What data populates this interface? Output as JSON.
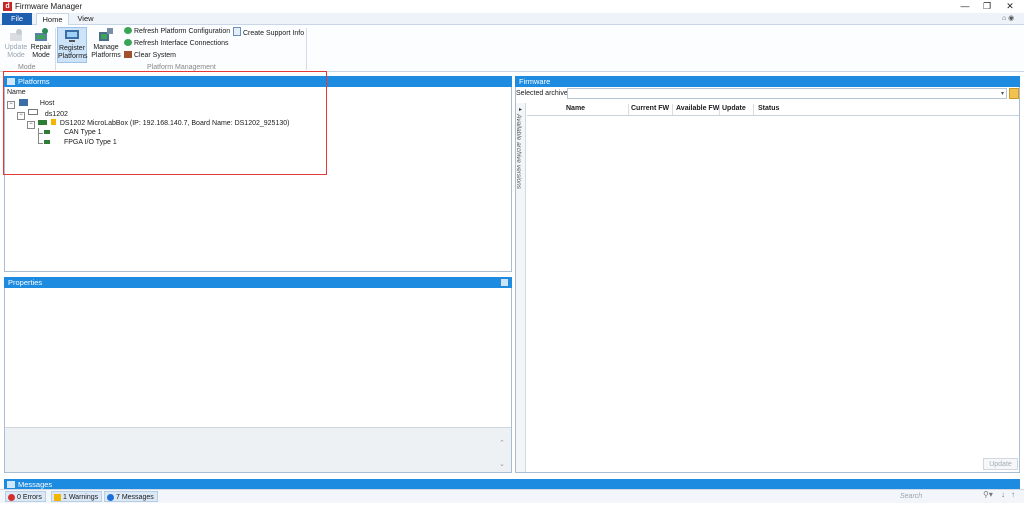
{
  "window": {
    "title": "Firmware Manager",
    "app_letter": "d",
    "minimize": "—",
    "restore": "❐",
    "close": "✕"
  },
  "menu": {
    "file": "File",
    "home": "Home",
    "view": "View",
    "icons": "⌂ ◉"
  },
  "ribbon": {
    "mode": {
      "update_line1": "Update",
      "update_line2": "Mode",
      "repair_line1": "Repair",
      "repair_line2": "Mode",
      "group": "Mode"
    },
    "platform": {
      "register_line1": "Register",
      "register_line2": "Platforms",
      "manage_line1": "Manage",
      "manage_line2": "Platforms",
      "refresh_platform": "Refresh Platform Configuration",
      "refresh_interface": "Refresh Interface Connections",
      "clear_system": "Clear System",
      "create_support": "Create Support Info",
      "group": "Platform Management"
    }
  },
  "platforms": {
    "header": "Platforms",
    "column": "Name",
    "tree": {
      "host": "Host",
      "ds": "ds1202",
      "board": "DS1202 MicroLabBox (IP: 192.168.140.7, Board Name: DS1202_925130)",
      "can": "CAN Type 1",
      "fpga": "FPGA I/O Type 1"
    }
  },
  "properties": {
    "header": "Properties"
  },
  "firmware": {
    "header": "Firmware",
    "selected_archive_label": "Selected archive",
    "side_tab": "Available archive versions",
    "columns": [
      "Name",
      "Current FW",
      "Available FW",
      "Update",
      "Status"
    ],
    "update_button": "Update"
  },
  "messages": {
    "header": "Messages",
    "errors": "0 Errors",
    "warnings": "1 Warnings",
    "messages": "7 Messages",
    "search_placeholder": "Search"
  },
  "colors": {
    "accent": "#1d8be0",
    "file_tab": "#1f5fb0",
    "highlight": "#e53935"
  }
}
